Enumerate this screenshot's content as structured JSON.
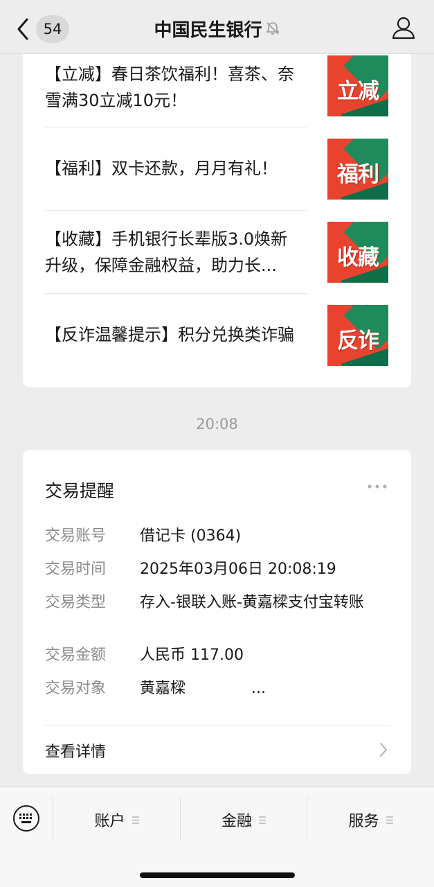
{
  "header": {
    "unread_count": "54",
    "title": "中国民生银行"
  },
  "articles": [
    {
      "title": "【立减】春日茶饮福利！喜茶、奈雪满30立减10元！",
      "thumb_text": "立减"
    },
    {
      "title": "【福利】双卡还款，月月有礼！",
      "thumb_text": "福利"
    },
    {
      "title": "【收藏】手机银行长辈版3.0焕新升级，保障金融权益，助力长...",
      "thumb_text": "收藏"
    },
    {
      "title": "【反诈温馨提示】积分兑换类诈骗",
      "thumb_text": "反诈"
    }
  ],
  "time": "20:08",
  "transaction": {
    "title": "交易提醒",
    "rows": [
      {
        "label": "交易账号",
        "value": "借记卡 (0364)"
      },
      {
        "label": "交易时间",
        "value": "2025年03月06日 20:08:19"
      },
      {
        "label": "交易类型",
        "value": "存入-银联入账-黄嘉樑支付宝转账"
      },
      {
        "label": "交易金额",
        "value": "人民币 117.00"
      },
      {
        "label": "交易对象",
        "value": "黄嘉樑",
        "value_suffix": "..."
      }
    ],
    "details_label": "查看详情"
  },
  "menu": {
    "items": [
      {
        "label": "账户"
      },
      {
        "label": "金融"
      },
      {
        "label": "服务"
      }
    ]
  },
  "colors": {
    "background": "#ededed",
    "card": "#ffffff",
    "thumb_red": "#e8432f",
    "thumb_green": "#1f8a5b"
  }
}
